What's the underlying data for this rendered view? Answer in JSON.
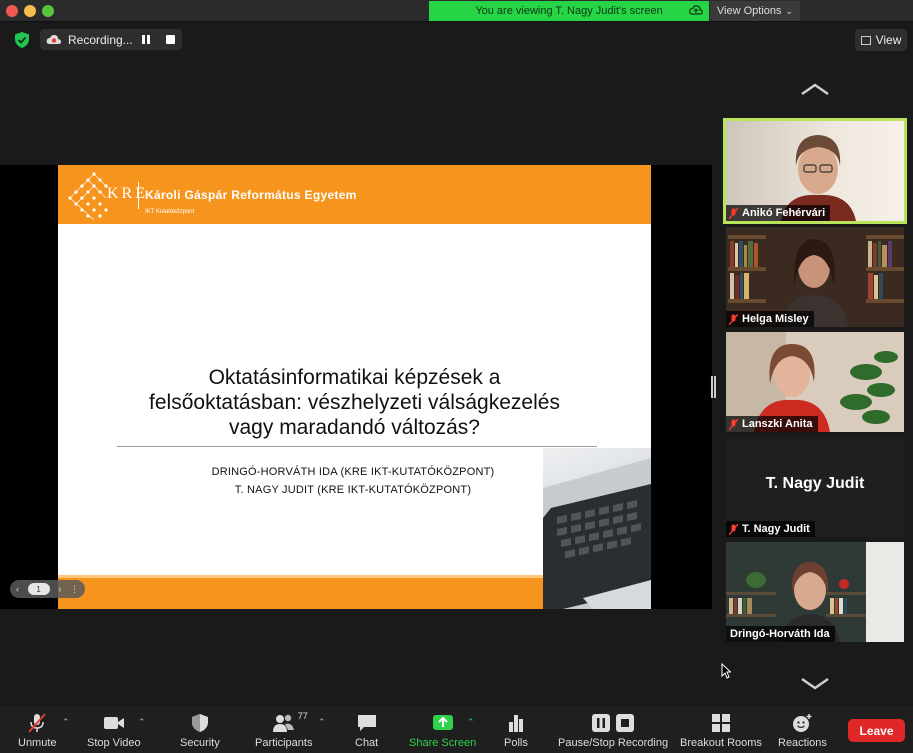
{
  "title_bar": {
    "banner": "You are viewing T. Nagy Judit's screen",
    "view_options": "View Options"
  },
  "top_bar": {
    "recording": "Recording...",
    "view": "View"
  },
  "slide": {
    "logo_text": "KRE",
    "university": "Károli Gáspár Református Egyetem",
    "department": "IKT Kutatóközpont",
    "title_lines": [
      "Oktatásinformatikai képzések a",
      "felsőoktatásban: vészhelyzeti válságkezelés",
      "vagy maradandó változás?"
    ],
    "authors": [
      "DRINGÓ-HORVÁTH IDA (KRE IKT-KUTATÓKÖZPONT)",
      "T. NAGY JUDIT (KRE IKT-KUTATÓKÖZPONT)"
    ],
    "accent_color": "#f7941d"
  },
  "page_nav": {
    "page": "1"
  },
  "participants": [
    {
      "name": "Anikó Fehérvári",
      "active": true
    },
    {
      "name": "Helga Misley"
    },
    {
      "name": "Lanszki Anita"
    },
    {
      "name": "T. Nagy Judit",
      "video_off_name": "T. Nagy Judit"
    },
    {
      "name": "Dringó-Horváth Ida"
    }
  ],
  "toolbar": {
    "unmute": "Unmute",
    "stop_video": "Stop Video",
    "security": "Security",
    "participants": "Participants",
    "participants_count": "77",
    "chat": "Chat",
    "share_screen": "Share Screen",
    "polls": "Polls",
    "pause_stop_recording": "Pause/Stop Recording",
    "breakout_rooms": "Breakout Rooms",
    "reactions": "Reactions",
    "leave": "Leave"
  }
}
